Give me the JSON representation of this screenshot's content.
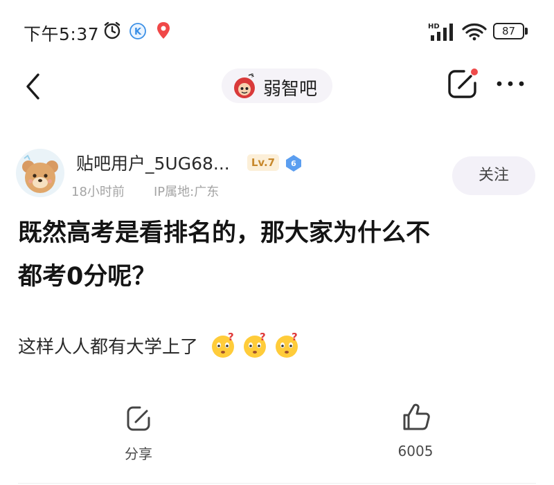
{
  "status_bar": {
    "time": "下午5:37",
    "network_label": "HD",
    "battery": "87"
  },
  "nav": {
    "forum_name": "弱智吧",
    "icons": [
      "back-arrow-icon",
      "forum-avatar-icon",
      "edit-icon",
      "more-icon"
    ]
  },
  "author": {
    "username": "贴吧用户_5UG68...",
    "level": "Lv.7",
    "verified_badge": "6",
    "time_ago": "18小时前",
    "ip_location": "IP属地:广东",
    "follow_label": "关注"
  },
  "post": {
    "title_line1": "既然高考是看排名的，那大家为什么不",
    "title_line2": "都考0分呢？",
    "body": "这样人人都有大学上了"
  },
  "actions": {
    "share_label": "分享",
    "like_count": "6005"
  },
  "colors": {
    "accent_red": "#ef4b4b",
    "level_badge_bg": "#fcefd8",
    "level_badge_text": "#c7882c",
    "verified_blue": "#5b9ef0",
    "pill_bg": "#f5f3f8"
  }
}
